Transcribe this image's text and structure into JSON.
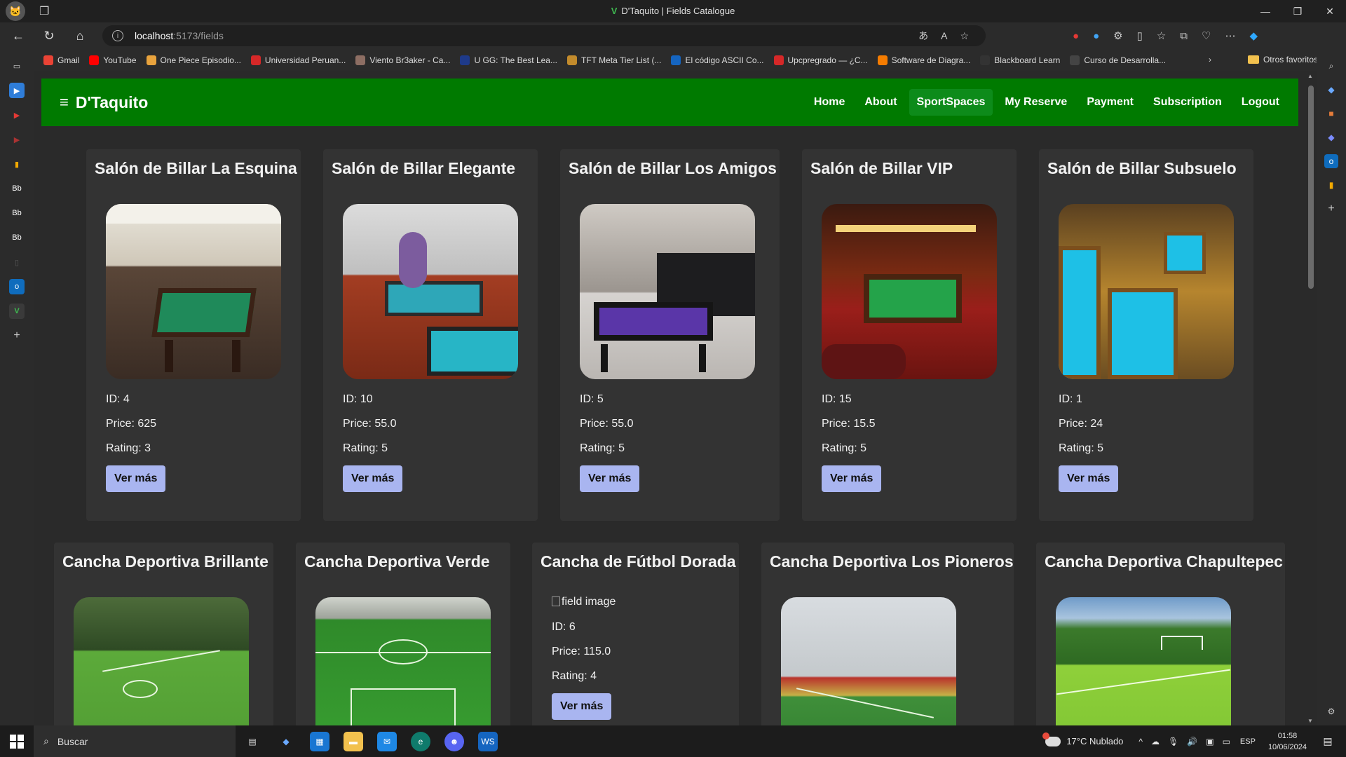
{
  "browser": {
    "window_title": "D'Taquito | Fields Catalogue",
    "url_host": "localhost",
    "url_path": ":5173/fields",
    "bookmarks": [
      {
        "label": "Gmail",
        "color": "#ea4335"
      },
      {
        "label": "YouTube",
        "color": "#ff0000"
      },
      {
        "label": "One Piece Episodio...",
        "color": "#e8a33d"
      },
      {
        "label": "Universidad Peruan...",
        "color": "#d62828"
      },
      {
        "label": "Viento Br3aker - Ca...",
        "color": "#8d6e63"
      },
      {
        "label": "U GG: The Best Lea...",
        "color": "#1e3a8a"
      },
      {
        "label": "TFT Meta Tier List (...",
        "color": "#c28b2c"
      },
      {
        "label": "El código ASCII Co...",
        "color": "#1565c0"
      },
      {
        "label": "Upcpregrado — ¿C...",
        "color": "#d62828"
      },
      {
        "label": "Software de Diagra...",
        "color": "#f57c00"
      },
      {
        "label": "Blackboard Learn",
        "color": "#333333"
      },
      {
        "label": "Curso de Desarrolla...",
        "color": "#444444"
      }
    ],
    "other_favorites": "Otros favoritos"
  },
  "app": {
    "brand": "D'Taquito",
    "nav": [
      {
        "label": "Home",
        "active": false
      },
      {
        "label": "About",
        "active": false
      },
      {
        "label": "SportSpaces",
        "active": true
      },
      {
        "label": "My Reserve",
        "active": false
      },
      {
        "label": "Payment",
        "active": false
      },
      {
        "label": "Subscription",
        "active": false
      },
      {
        "label": "Logout",
        "active": false
      }
    ],
    "button_label": "Ver más",
    "broken_image_alt": "field image"
  },
  "fields": [
    {
      "name": "Salón de Billar La Esquina",
      "id": "ID: 4",
      "price": "Price: 625",
      "rating": "Rating: 3",
      "image": "billiards-green"
    },
    {
      "name": "Salón de Billar Elegante",
      "id": "ID: 10",
      "price": "Price: 55.0",
      "rating": "Rating: 5",
      "image": "billiards-blue"
    },
    {
      "name": "Salón de Billar Los Amigos",
      "id": "ID: 5",
      "price": "Price: 55.0",
      "rating": "Rating: 5",
      "image": "billiards-purple"
    },
    {
      "name": "Salón de Billar VIP",
      "id": "ID: 15",
      "price": "Price: 15.5",
      "rating": "Rating: 5",
      "image": "billiards-red"
    },
    {
      "name": "Salón de Billar Subsuelo",
      "id": "ID: 1",
      "price": "Price: 24",
      "rating": "Rating: 5",
      "image": "billiards-cyan"
    },
    {
      "name": "Cancha Deportiva Brillante",
      "image": "soccer-aerial"
    },
    {
      "name": "Cancha Deportiva Verde",
      "image": "soccer-indoor"
    },
    {
      "name": "Cancha de Fútbol Dorada",
      "id": "ID: 6",
      "price": "Price: 115.0",
      "rating": "Rating: 4",
      "image": "broken"
    },
    {
      "name": "Cancha Deportiva Los Pioneros",
      "image": "soccer-fenced"
    },
    {
      "name": "Cancha Deportiva Chapultepec",
      "image": "soccer-park"
    }
  ],
  "taskbar": {
    "search_placeholder": "Buscar",
    "weather": "17°C  Nublado",
    "lang": "ESP",
    "time": "01:58",
    "date": "10/06/2024"
  }
}
